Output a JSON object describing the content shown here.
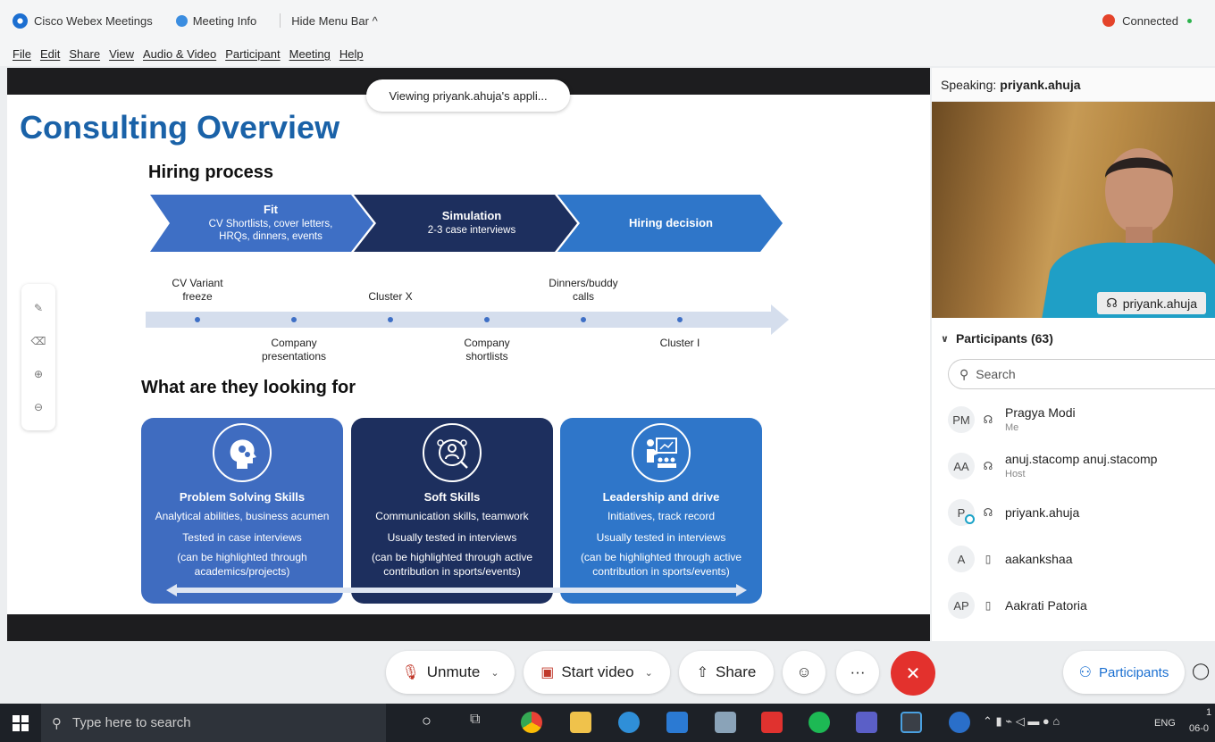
{
  "window": {
    "app_name": "Cisco Webex Meetings",
    "meeting_info": "Meeting Info",
    "hide_menu_bar": "Hide Menu Bar ^",
    "status": "Connected",
    "status_color": "#2bb24c"
  },
  "menu": [
    "File",
    "Edit",
    "Share",
    "View",
    "Audio & Video",
    "Participant",
    "Meeting",
    "Help"
  ],
  "share": {
    "viewing_banner": "Viewing priyank.ahuja's appli..."
  },
  "slide": {
    "title": "Consulting Overview",
    "hiring_heading": "Hiring process",
    "stages": [
      {
        "title": "Fit",
        "desc1": "CV Shortlists, cover letters,",
        "desc2": "HRQs, dinners, events",
        "color": "#3e6fc5"
      },
      {
        "title": "Simulation",
        "desc1": "2-3 case interviews",
        "desc2": "",
        "color": "#1d2f5e"
      },
      {
        "title": "Hiring decision",
        "desc1": "",
        "desc2": "",
        "color": "#2f76c9"
      }
    ],
    "timeline_top": [
      {
        "line1": "CV Variant",
        "line2": "freeze"
      },
      {
        "line1": "Cluster X",
        "line2": ""
      },
      {
        "line1": "Dinners/buddy",
        "line2": "calls"
      }
    ],
    "timeline_bottom": [
      {
        "line1": "Company",
        "line2": "presentations"
      },
      {
        "line1": "Company",
        "line2": "shortlists"
      },
      {
        "line1": "Cluster I",
        "line2": ""
      }
    ],
    "looking_heading": "What are they looking for",
    "cards": [
      {
        "title": "Problem Solving Skills",
        "line1": "Analytical abilities, business acumen",
        "line2": "Tested in case interviews",
        "line3": "(can be highlighted through academics/projects)",
        "color": "#3f6cc0",
        "icon": "head-gears-icon"
      },
      {
        "title": "Soft Skills",
        "line1": "Communication skills, teamwork",
        "line2": "Usually tested in interviews",
        "line3": "(can be highlighted through active contribution in sports/events)",
        "color": "#1d2f5e",
        "icon": "people-network-icon"
      },
      {
        "title": "Leadership and drive",
        "line1": "Initiatives, track record",
        "line2": "Usually tested in interviews",
        "line3": "(can be highlighted through active contribution in sports/events)",
        "color": "#2f76c9",
        "icon": "presenter-icon"
      }
    ]
  },
  "side_tools": [
    "annotate-icon",
    "eraser-icon",
    "zoom-in-icon",
    "zoom-out-icon"
  ],
  "right_panel": {
    "speaking_label": "Speaking:",
    "speaking_name": "priyank.ahuja",
    "video_name": "priyank.ahuja",
    "participants_label": "Participants (63)",
    "search_placeholder": "Search",
    "participants": [
      {
        "initials": "PM",
        "name": "Pragya Modi",
        "role": "Me",
        "device": "headset-icon"
      },
      {
        "initials": "AA",
        "name": "anuj.stacomp anuj.stacomp",
        "role": "Host",
        "device": "headset-icon"
      },
      {
        "initials": "P",
        "name": "priyank.ahuja",
        "role": "",
        "device": "headset-icon"
      },
      {
        "initials": "A",
        "name": "aakankshaa",
        "role": "",
        "device": "phone-icon"
      },
      {
        "initials": "AP",
        "name": "Aakrati Patoria",
        "role": "",
        "device": "phone-icon"
      }
    ]
  },
  "controls": {
    "unmute": "Unmute",
    "start_video": "Start video",
    "share": "Share",
    "reactions_icon": "emoji-icon",
    "more": "···",
    "end_icon": "close-icon",
    "participants": "Participants"
  },
  "taskbar": {
    "search_placeholder": "Type here to search",
    "language": "ENG",
    "clock_time": "1",
    "clock_date": "06-0"
  }
}
